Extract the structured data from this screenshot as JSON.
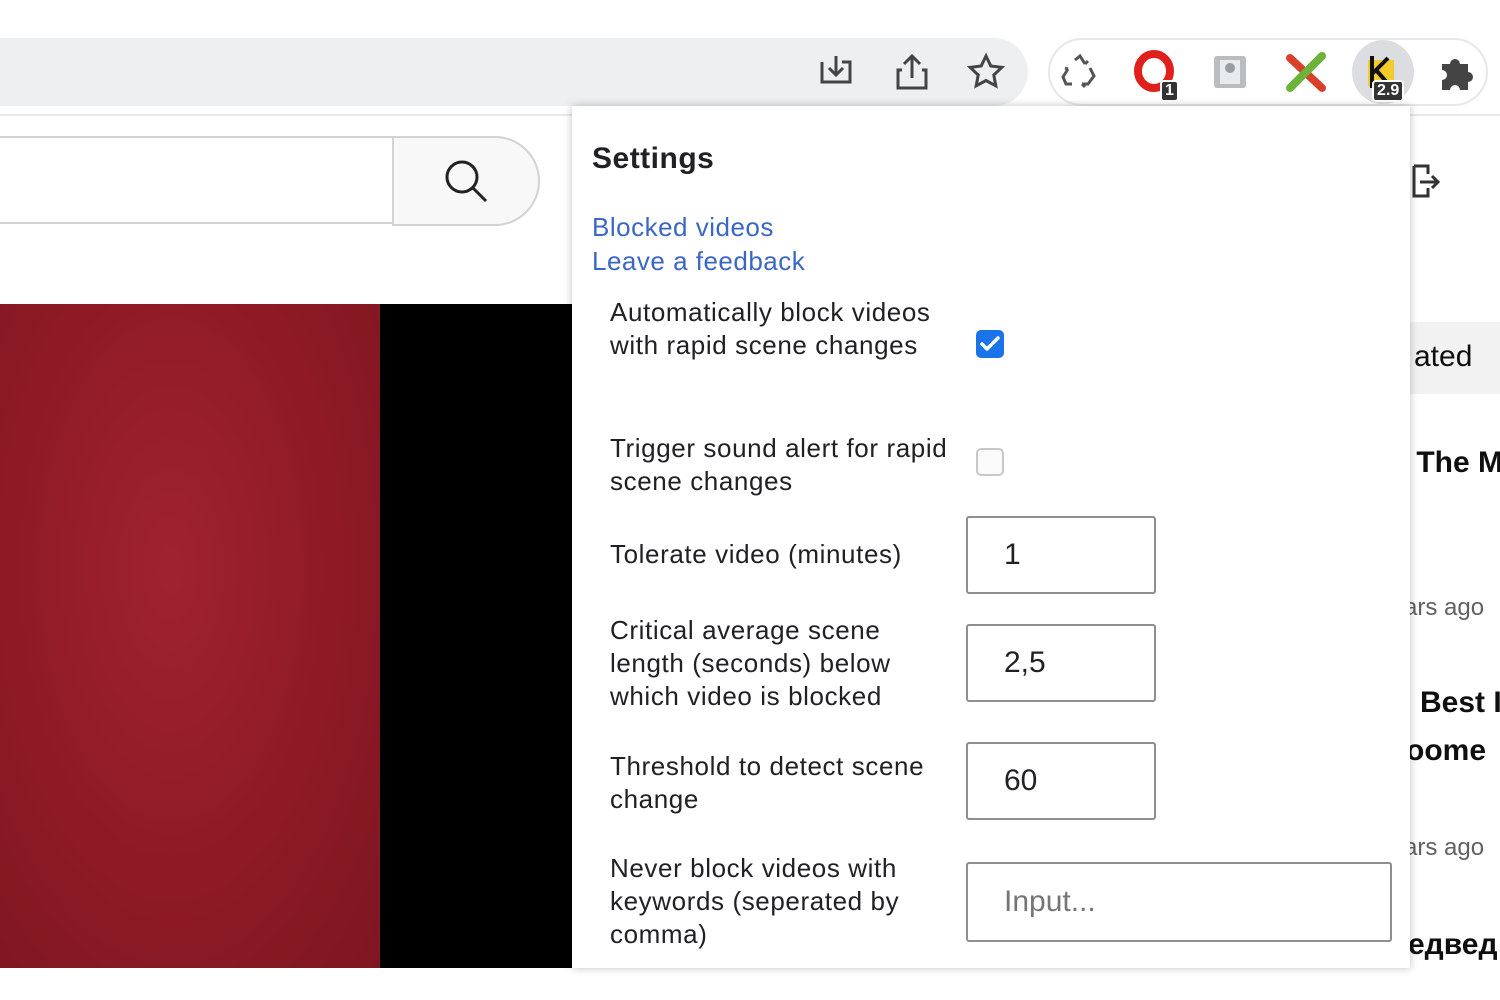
{
  "toolbar": {
    "icons": [
      "install-icon",
      "share-icon",
      "bookmark-star-icon"
    ],
    "extensions": [
      {
        "name": "recycle-icon"
      },
      {
        "name": "opera-o-icon",
        "badge": "1"
      },
      {
        "name": "photo-extension-icon"
      },
      {
        "name": "cross-extension-icon"
      },
      {
        "name": "k-extension-icon",
        "badge": "2.9"
      },
      {
        "name": "puzzle-icon"
      }
    ]
  },
  "page": {
    "side_chip": "ated",
    "side_lines": [
      "t The M",
      "ars ago",
      "Best I",
      "oome",
      "ars ago",
      "едвед"
    ]
  },
  "popup": {
    "title": "Settings",
    "links": [
      "Blocked videos",
      "Leave a feedback"
    ],
    "rows": [
      {
        "label": "Automatically block videos with rapid scene changes",
        "type": "checkbox",
        "checked": true
      },
      {
        "label": "Trigger sound alert for rapid scene changes",
        "type": "checkbox",
        "checked": false
      },
      {
        "label": "Tolerate video (minutes)",
        "type": "number",
        "value": "1"
      },
      {
        "label": "Critical average scene length (seconds) below which video is blocked",
        "type": "number",
        "value": "2,5"
      },
      {
        "label": "Threshold to detect scene change",
        "type": "number",
        "value": "60"
      },
      {
        "label": "Never block videos with keywords (seperated by comma)",
        "type": "text",
        "value": "",
        "placeholder": "Input..."
      }
    ]
  },
  "colors": {
    "link": "#3b67c4",
    "checkbox_checked": "#1a73e8",
    "video_red": "#8e1a25"
  }
}
